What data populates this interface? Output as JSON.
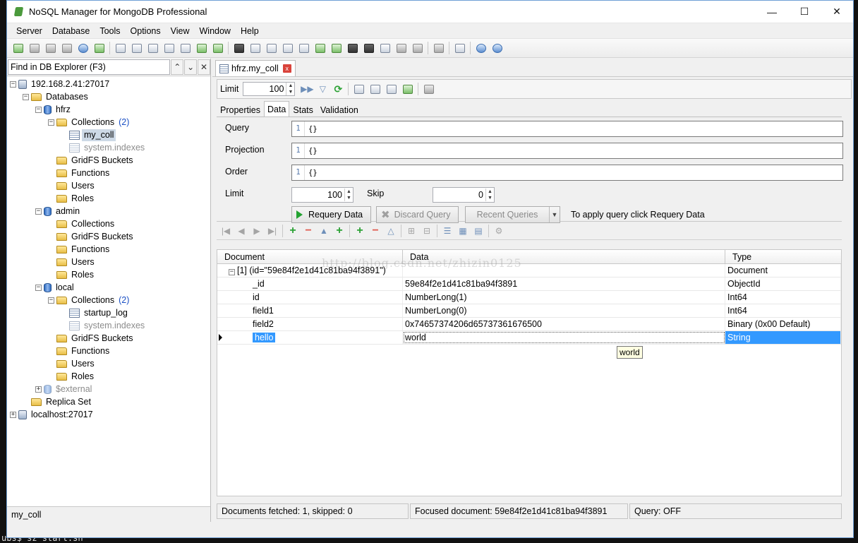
{
  "window": {
    "title": "NoSQL Manager for MongoDB Professional",
    "controls": {
      "minimize": "—",
      "maximize": "☐",
      "close": "✕"
    }
  },
  "menu": [
    "Server",
    "Database",
    "Tools",
    "Options",
    "View",
    "Window",
    "Help"
  ],
  "explorer": {
    "find_value": "Find in DB Explorer (F3)",
    "status": "my_coll",
    "tree": [
      {
        "label": "192.168.2.41:27017",
        "icon": "server-icon",
        "level": 0,
        "expanded": true
      },
      {
        "label": "Databases",
        "icon": "folder-icon",
        "level": 1,
        "expanded": true
      },
      {
        "label": "hfrz",
        "icon": "database-icon",
        "level": 2,
        "expanded": true
      },
      {
        "label": "Collections",
        "count": "(2)",
        "icon": "folder-icon",
        "level": 3,
        "expanded": true
      },
      {
        "label": "my_coll",
        "icon": "collection-icon",
        "level": 4,
        "selected": true
      },
      {
        "label": "system.indexes",
        "icon": "collection-icon",
        "level": 4,
        "dim": true
      },
      {
        "label": "GridFS Buckets",
        "icon": "folder-icon",
        "level": 3
      },
      {
        "label": "Functions",
        "icon": "folder-icon",
        "level": 3
      },
      {
        "label": "Users",
        "icon": "folder-icon",
        "level": 3
      },
      {
        "label": "Roles",
        "icon": "folder-icon",
        "level": 3
      },
      {
        "label": "admin",
        "icon": "database-icon",
        "level": 2,
        "expanded": true
      },
      {
        "label": "Collections",
        "icon": "folder-icon",
        "level": 3
      },
      {
        "label": "GridFS Buckets",
        "icon": "folder-icon",
        "level": 3
      },
      {
        "label": "Functions",
        "icon": "folder-icon",
        "level": 3
      },
      {
        "label": "Users",
        "icon": "folder-icon",
        "level": 3
      },
      {
        "label": "Roles",
        "icon": "folder-icon",
        "level": 3
      },
      {
        "label": "local",
        "icon": "database-icon",
        "level": 2,
        "expanded": true
      },
      {
        "label": "Collections",
        "count": "(2)",
        "icon": "folder-icon",
        "level": 3,
        "expanded": true
      },
      {
        "label": "startup_log",
        "icon": "collection-icon",
        "level": 4
      },
      {
        "label": "system.indexes",
        "icon": "collection-icon",
        "level": 4,
        "dim": true
      },
      {
        "label": "GridFS Buckets",
        "icon": "folder-icon",
        "level": 3
      },
      {
        "label": "Functions",
        "icon": "folder-icon",
        "level": 3
      },
      {
        "label": "Users",
        "icon": "folder-icon",
        "level": 3
      },
      {
        "label": "Roles",
        "icon": "folder-icon",
        "level": 3
      },
      {
        "label": "$external",
        "icon": "database-icon",
        "level": 2,
        "dim": true,
        "collapsed": true
      },
      {
        "label": "Replica Set",
        "icon": "folder-icon",
        "level": 1
      },
      {
        "label": "localhost:27017",
        "icon": "server-icon",
        "level": 0,
        "collapsed": true
      }
    ]
  },
  "doc_tab": {
    "label": "hfrz.my_coll",
    "close": "x"
  },
  "limit_bar": {
    "label": "Limit",
    "value": "100"
  },
  "sub_tabs": [
    "Properties",
    "Data",
    "Stats",
    "Validation"
  ],
  "query": {
    "query_label": "Query",
    "query_line": "1",
    "query_value": "{}",
    "projection_label": "Projection",
    "projection_line": "1",
    "projection_value": "{}",
    "order_label": "Order",
    "order_line": "1",
    "order_value": "{}",
    "limit_label": "Limit",
    "limit_value": "100",
    "skip_label": "Skip",
    "skip_value": "0",
    "requery": "Requery Data",
    "discard": "Discard Query",
    "recent": "Recent Queries",
    "hint": "To apply query click Requery Data"
  },
  "grid": {
    "columns": [
      "Document",
      "Data",
      "Type"
    ],
    "rows": [
      {
        "doc": "[1] (id=\"59e84f2e1d41c81ba94f3891\")",
        "data": "",
        "type": "Document",
        "level": 0
      },
      {
        "doc": "_id",
        "data": "59e84f2e1d41c81ba94f3891",
        "type": "ObjectId",
        "level": 1
      },
      {
        "doc": "id",
        "data": "NumberLong(1)",
        "type": "Int64",
        "level": 1
      },
      {
        "doc": "field1",
        "data": "NumberLong(0)",
        "type": "Int64",
        "level": 1
      },
      {
        "doc": "field2",
        "data": "0x74657374206d65737361676500",
        "type": "Binary (0x00 Default)",
        "level": 1
      },
      {
        "doc": "hello",
        "data": "world",
        "type": "String",
        "level": 1,
        "selected": true
      }
    ],
    "tooltip": "world",
    "watermark": "http://blog.csdn.net/zhizin0125"
  },
  "status": {
    "fetched": "Documents fetched: 1, skipped: 0",
    "focused": "Focused document: 59e84f2e1d41c81ba94f3891",
    "query": "Query: OFF"
  },
  "terminal": {
    "text": "ubs$ sz start.sh"
  },
  "colors": {
    "selection": "#3399ff",
    "tree_selection": "#cdd9e6",
    "count": "#1a4fc4"
  }
}
